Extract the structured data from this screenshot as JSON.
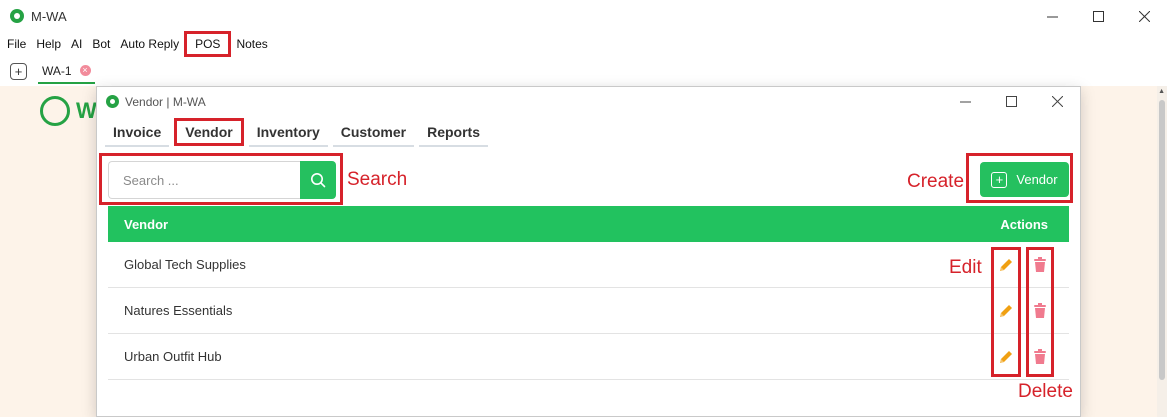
{
  "window": {
    "title": "M-WA"
  },
  "menu": [
    {
      "label": "File"
    },
    {
      "label": "Help"
    },
    {
      "label": "AI"
    },
    {
      "label": "Bot"
    },
    {
      "label": "Auto Reply"
    },
    {
      "label": "POS"
    },
    {
      "label": "Notes"
    }
  ],
  "tabs": {
    "add_label": "+",
    "active_tab": "WA-1",
    "close_glyph": "×"
  },
  "background": {
    "logo_letter": "W"
  },
  "dialog": {
    "title": "Vendor | M-WA",
    "tabs": [
      {
        "label": "Invoice"
      },
      {
        "label": "Vendor"
      },
      {
        "label": "Inventory"
      },
      {
        "label": "Customer"
      },
      {
        "label": "Reports"
      }
    ],
    "search": {
      "placeholder": "Search ..."
    },
    "create_button": {
      "label": "Vendor"
    },
    "table": {
      "headers": {
        "vendor": "Vendor",
        "actions": "Actions"
      },
      "rows": [
        {
          "name": "Global Tech Supplies"
        },
        {
          "name": "Natures Essentials"
        },
        {
          "name": "Urban Outfit Hub"
        }
      ]
    }
  },
  "annotations": {
    "search": "Search",
    "create": "Create",
    "edit": "Edit",
    "delete": "Delete"
  },
  "colors": {
    "accent_green": "#22c25f",
    "highlight_red": "#d6222a",
    "edit_icon": "#f0a012",
    "delete_icon": "#f07a8e"
  }
}
